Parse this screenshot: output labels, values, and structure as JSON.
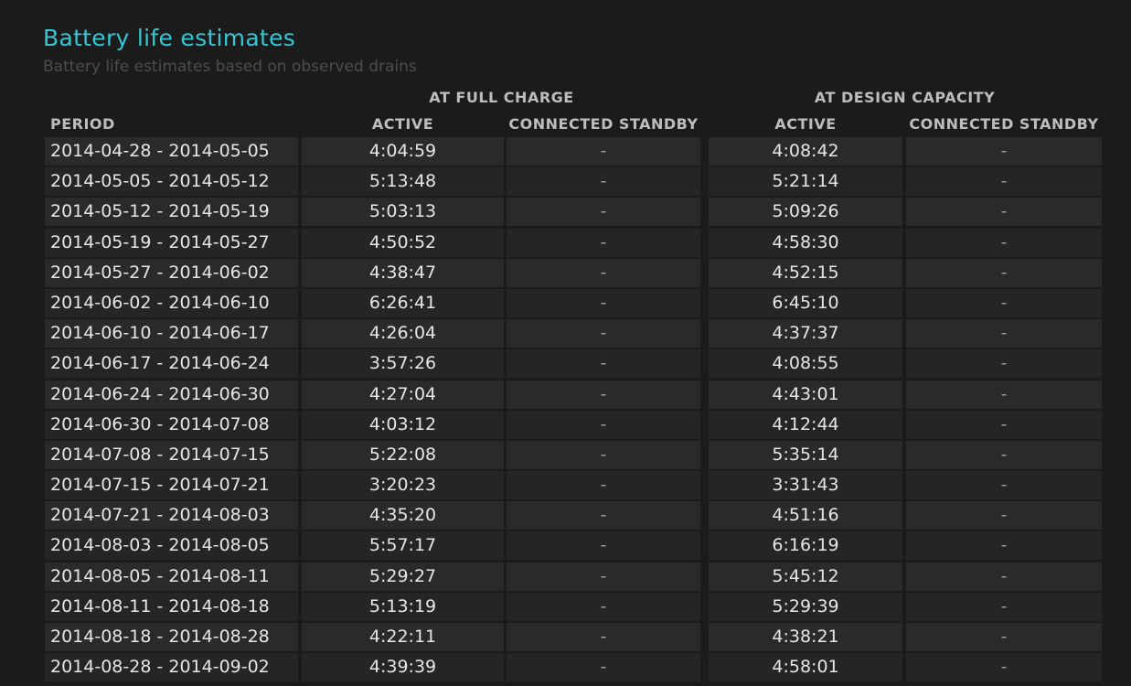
{
  "title": "Battery life estimates",
  "subtitle": "Battery life estimates based on observed drains",
  "groups": {
    "full_charge": "AT FULL CHARGE",
    "design_capacity": "AT DESIGN CAPACITY"
  },
  "columns": {
    "period": "PERIOD",
    "fc_active": "ACTIVE",
    "fc_standby": "CONNECTED STANDBY",
    "dc_active": "ACTIVE",
    "dc_standby": "CONNECTED STANDBY"
  },
  "rows": [
    {
      "period": "2014-04-28 - 2014-05-05",
      "fc_active": "4:04:59",
      "fc_standby": "-",
      "dc_active": "4:08:42",
      "dc_standby": "-"
    },
    {
      "period": "2014-05-05 - 2014-05-12",
      "fc_active": "5:13:48",
      "fc_standby": "-",
      "dc_active": "5:21:14",
      "dc_standby": "-"
    },
    {
      "period": "2014-05-12 - 2014-05-19",
      "fc_active": "5:03:13",
      "fc_standby": "-",
      "dc_active": "5:09:26",
      "dc_standby": "-"
    },
    {
      "period": "2014-05-19 - 2014-05-27",
      "fc_active": "4:50:52",
      "fc_standby": "-",
      "dc_active": "4:58:30",
      "dc_standby": "-"
    },
    {
      "period": "2014-05-27 - 2014-06-02",
      "fc_active": "4:38:47",
      "fc_standby": "-",
      "dc_active": "4:52:15",
      "dc_standby": "-"
    },
    {
      "period": "2014-06-02 - 2014-06-10",
      "fc_active": "6:26:41",
      "fc_standby": "-",
      "dc_active": "6:45:10",
      "dc_standby": "-"
    },
    {
      "period": "2014-06-10 - 2014-06-17",
      "fc_active": "4:26:04",
      "fc_standby": "-",
      "dc_active": "4:37:37",
      "dc_standby": "-"
    },
    {
      "period": "2014-06-17 - 2014-06-24",
      "fc_active": "3:57:26",
      "fc_standby": "-",
      "dc_active": "4:08:55",
      "dc_standby": "-"
    },
    {
      "period": "2014-06-24 - 2014-06-30",
      "fc_active": "4:27:04",
      "fc_standby": "-",
      "dc_active": "4:43:01",
      "dc_standby": "-"
    },
    {
      "period": "2014-06-30 - 2014-07-08",
      "fc_active": "4:03:12",
      "fc_standby": "-",
      "dc_active": "4:12:44",
      "dc_standby": "-"
    },
    {
      "period": "2014-07-08 - 2014-07-15",
      "fc_active": "5:22:08",
      "fc_standby": "-",
      "dc_active": "5:35:14",
      "dc_standby": "-"
    },
    {
      "period": "2014-07-15 - 2014-07-21",
      "fc_active": "3:20:23",
      "fc_standby": "-",
      "dc_active": "3:31:43",
      "dc_standby": "-"
    },
    {
      "period": "2014-07-21 - 2014-08-03",
      "fc_active": "4:35:20",
      "fc_standby": "-",
      "dc_active": "4:51:16",
      "dc_standby": "-"
    },
    {
      "period": "2014-08-03 - 2014-08-05",
      "fc_active": "5:57:17",
      "fc_standby": "-",
      "dc_active": "6:16:19",
      "dc_standby": "-"
    },
    {
      "period": "2014-08-05 - 2014-08-11",
      "fc_active": "5:29:27",
      "fc_standby": "-",
      "dc_active": "5:45:12",
      "dc_standby": "-"
    },
    {
      "period": "2014-08-11 - 2014-08-18",
      "fc_active": "5:13:19",
      "fc_standby": "-",
      "dc_active": "5:29:39",
      "dc_standby": "-"
    },
    {
      "period": "2014-08-18 - 2014-08-28",
      "fc_active": "4:22:11",
      "fc_standby": "-",
      "dc_active": "4:38:21",
      "dc_standby": "-"
    },
    {
      "period": "2014-08-28 - 2014-09-02",
      "fc_active": "4:39:39",
      "fc_standby": "-",
      "dc_active": "4:58:01",
      "dc_standby": "-"
    }
  ],
  "colors": {
    "background": "#1b1b1b",
    "title": "#36c6d6",
    "subtitle": "#4d4d4d",
    "header": "#bdbdbd",
    "cell_bg": "#2a2a2a",
    "text": "#e6e6e6"
  }
}
